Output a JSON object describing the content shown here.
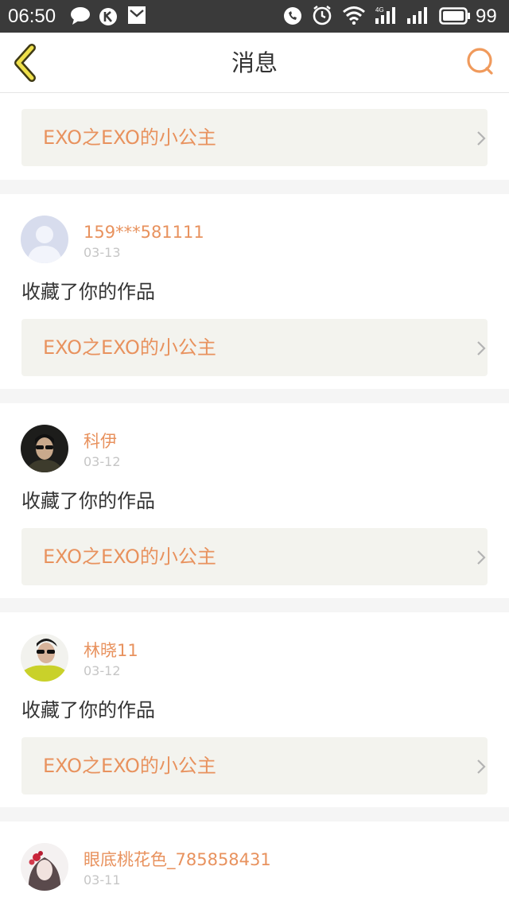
{
  "status_bar": {
    "time": "06:50",
    "battery": "99",
    "icons": [
      "chat-bubble-icon",
      "k-app-icon",
      "mail-icon",
      "phone-icon",
      "alarm-icon",
      "wifi-icon",
      "4g-signal-icon",
      "signal-icon",
      "battery-icon"
    ]
  },
  "nav": {
    "title": "消息",
    "back_icon": "chevron-left-icon",
    "search_icon": "search-icon"
  },
  "colors": {
    "accent": "#e8925e",
    "work_link_bg": "#f3f3ee",
    "status_bar_bg": "#3a3a3a"
  },
  "messages": [
    {
      "work_title": "EXO之EXO的小公主"
    },
    {
      "username": "159***581111",
      "date": "03-13",
      "action": "收藏了你的作品",
      "work_title": "EXO之EXO的小公主",
      "avatar": "default-avatar"
    },
    {
      "username": "科伊",
      "date": "03-12",
      "action": "收藏了你的作品",
      "work_title": "EXO之EXO的小公主",
      "avatar": "photo-avatar"
    },
    {
      "username": "林晓11",
      "date": "03-12",
      "action": "收藏了你的作品",
      "work_title": "EXO之EXO的小公主",
      "avatar": "photo-avatar"
    },
    {
      "username": "眼底桃花色_785858431",
      "date": "03-11",
      "avatar": "photo-avatar"
    }
  ]
}
